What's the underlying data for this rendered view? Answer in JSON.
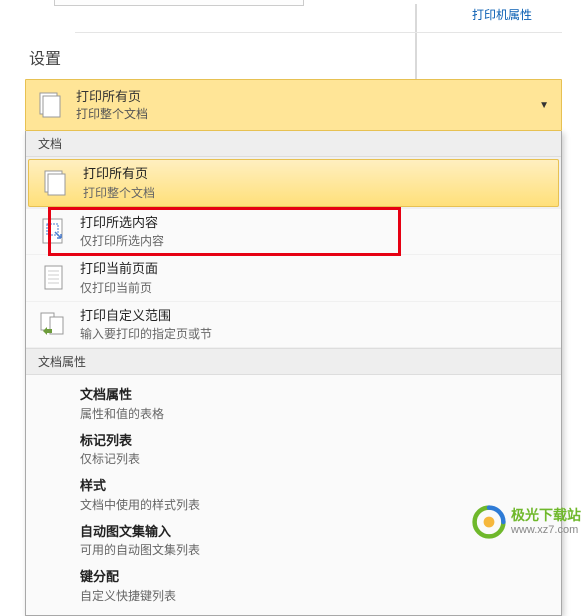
{
  "links": {
    "printer_properties": "打印机属性"
  },
  "labels": {
    "settings": "设置"
  },
  "selected": {
    "title": "打印所有页",
    "subtitle": "打印整个文档"
  },
  "groups": {
    "document": "文档",
    "document_properties": "文档属性"
  },
  "menu": {
    "all_pages": {
      "title": "打印所有页",
      "subtitle": "打印整个文档"
    },
    "selection": {
      "title": "打印所选内容",
      "subtitle": "仅打印所选内容"
    },
    "current_page": {
      "title": "打印当前页面",
      "subtitle": "仅打印当前页"
    },
    "custom_range": {
      "title": "打印自定义范围",
      "subtitle": "输入要打印的指定页或节"
    }
  },
  "props": {
    "doc_props": {
      "title": "文档属性",
      "subtitle": "属性和值的表格"
    },
    "markup_list": {
      "title": "标记列表",
      "subtitle": "仅标记列表"
    },
    "styles": {
      "title": "样式",
      "subtitle": "文档中使用的样式列表"
    },
    "autotext": {
      "title": "自动图文集输入",
      "subtitle": "可用的自动图文集列表"
    },
    "key_assign": {
      "title": "键分配",
      "subtitle": "自定义快捷键列表"
    }
  },
  "watermark": {
    "name": "极光下载站",
    "url": "www.xz7.com"
  }
}
